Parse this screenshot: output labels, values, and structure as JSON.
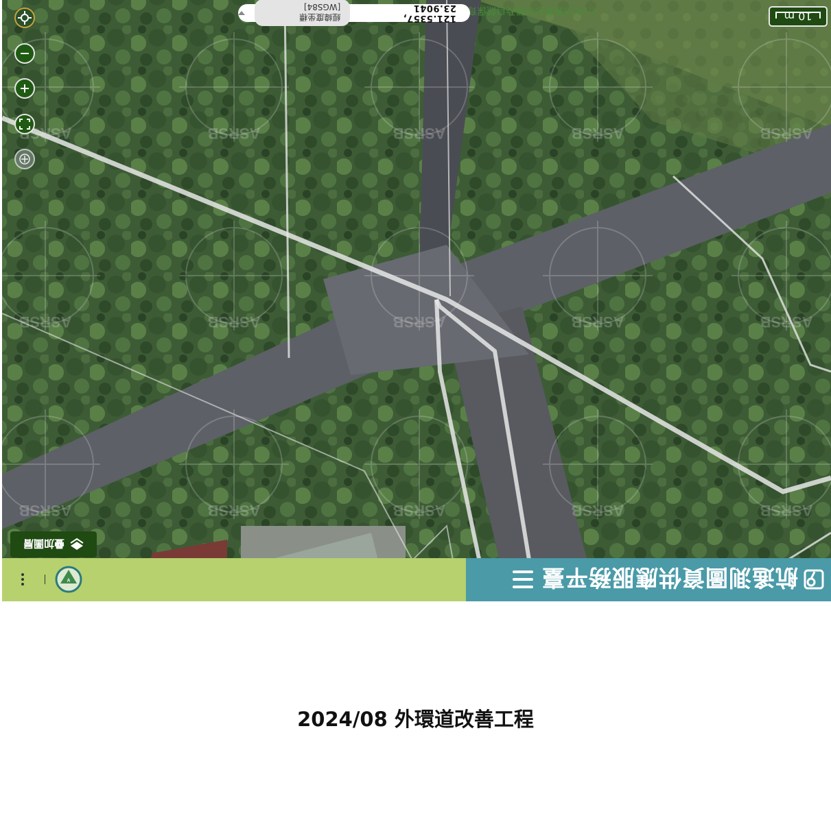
{
  "header": {
    "brand_title": "航遙測圖資供應服務平臺",
    "menu_icon": "hamburger-icon",
    "emblem_icon": "agency-emblem-icon",
    "more_icon": "more-vertical-icon",
    "brand_color": "#4a9aa8",
    "status_color": "#b6d16e"
  },
  "map": {
    "scale_label": "10 m",
    "coordinates": "121.5357, 23.9041",
    "coordinate_system": "經緯度坐標[WGS84]",
    "copyright": "©2025農業部林業及自然保育署",
    "watermark": "ASRSB",
    "layers_button_label": "疊加圖層",
    "layers_icon": "layers-icon",
    "controls": {
      "locate_icon": "locate-icon",
      "zoom_out_icon": "zoom-out-icon",
      "zoom_in_icon": "zoom-in-icon",
      "fullscreen_icon": "fullscreen-icon",
      "compass_icon": "compass-icon"
    }
  },
  "caption": "2024/08 外環道改善工程"
}
